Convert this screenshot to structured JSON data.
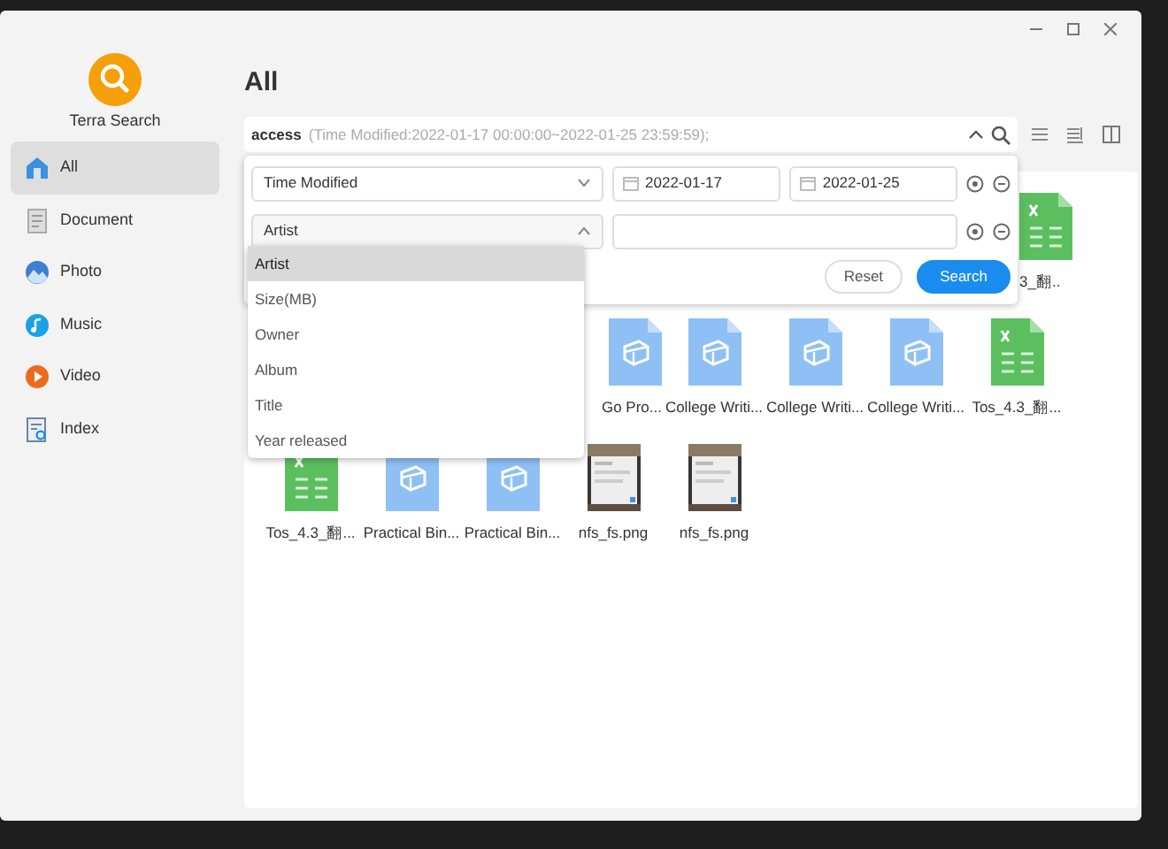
{
  "app": {
    "name": "Terra Search"
  },
  "sidebar": {
    "items": [
      {
        "label": "All",
        "selected": true
      },
      {
        "label": "Document",
        "selected": false
      },
      {
        "label": "Photo",
        "selected": false
      },
      {
        "label": "Music",
        "selected": false
      },
      {
        "label": "Video",
        "selected": false
      },
      {
        "label": "Index",
        "selected": false
      }
    ]
  },
  "page_title": "All",
  "search": {
    "query": "access",
    "summary": "(Time Modified:2022-01-17 00:00:00~2022-01-25 23:59:59);"
  },
  "filters": [
    {
      "field": "Time Modified",
      "expanded": false,
      "kind": "date_range",
      "from": "2022-01-17",
      "to": "2022-01-25"
    },
    {
      "field": "Artist",
      "expanded": true,
      "kind": "text"
    }
  ],
  "filter_buttons": {
    "reset": "Reset",
    "search": "Search"
  },
  "field_options": [
    {
      "label": "Artist",
      "selected": true
    },
    {
      "label": "Size(MB)",
      "selected": false
    },
    {
      "label": "Owner",
      "selected": false
    },
    {
      "label": "Album",
      "selected": false
    },
    {
      "label": "Title",
      "selected": false
    },
    {
      "label": "Year released",
      "selected": false
    }
  ],
  "file_rows": [
    [
      {
        "name": "3_翻..",
        "kind": "spreadsheet"
      }
    ],
    [
      {
        "name": "Go Pro...",
        "kind": "document"
      },
      {
        "name": "College Writi...",
        "kind": "document"
      },
      {
        "name": "College Writi...",
        "kind": "document"
      },
      {
        "name": "College Writi...",
        "kind": "document"
      },
      {
        "name": "Tos_4.3_翻...",
        "kind": "spreadsheet"
      }
    ],
    [
      {
        "name": "Tos_4.3_翻...",
        "kind": "spreadsheet"
      },
      {
        "name": "Practical Bin...",
        "kind": "document"
      },
      {
        "name": "Practical Bin...",
        "kind": "document"
      },
      {
        "name": "nfs_fs.png"
      },
      {
        "name": "nfs_fs.png"
      }
    ]
  ]
}
